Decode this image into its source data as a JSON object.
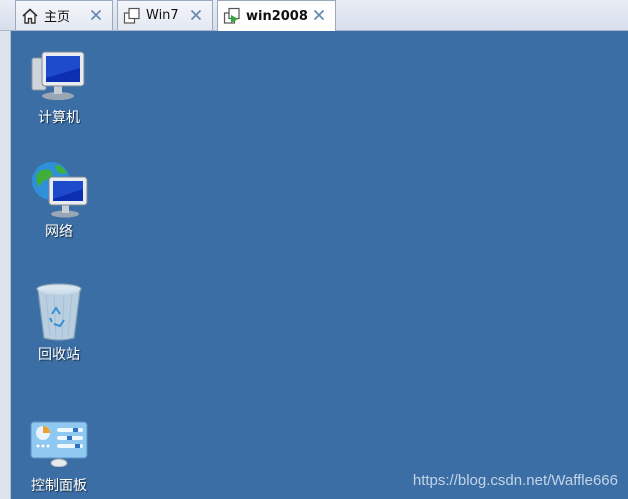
{
  "tabs": [
    {
      "label": "主页",
      "icon": "home-icon",
      "active": false
    },
    {
      "label": "Win7",
      "icon": "vm-icon",
      "active": false
    },
    {
      "label": "win2008",
      "icon": "vm-running-icon",
      "active": true
    }
  ],
  "desktop": {
    "background": "#3a6ea5",
    "icons": [
      {
        "label": "计算机",
        "icon": "computer-icon"
      },
      {
        "label": "网络",
        "icon": "network-icon"
      },
      {
        "label": "回收站",
        "icon": "recycle-bin-icon"
      },
      {
        "label": "控制面板",
        "icon": "control-panel-icon"
      }
    ]
  },
  "watermark": "https://blog.csdn.net/Waffle666",
  "colors": {
    "accent": "#3a6ea5",
    "close": "#5a7ea8"
  }
}
